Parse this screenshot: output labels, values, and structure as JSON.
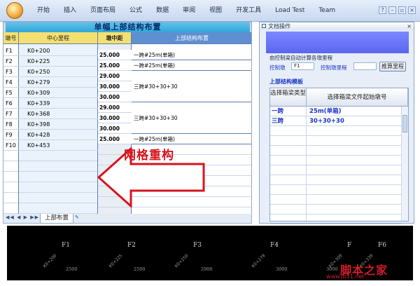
{
  "ribbon": {
    "tabs": [
      "开始",
      "插入",
      "页面布局",
      "公式",
      "数据",
      "审阅",
      "视图",
      "开发工具",
      "Load Test",
      "Team"
    ]
  },
  "sheet": {
    "title": "单幅上部结构布置",
    "headers": {
      "pier": "墩号",
      "station": "中心里程",
      "span": "墩中距",
      "layout": "上部结构布置"
    },
    "piers": [
      {
        "pier": "F1",
        "station": "K0+200"
      },
      {
        "pier": "F2",
        "station": "K0+225"
      },
      {
        "pier": "F3",
        "station": "K0+250"
      },
      {
        "pier": "F4",
        "station": "K0+279"
      },
      {
        "pier": "F5",
        "station": "K0+309"
      },
      {
        "pier": "F6",
        "station": "K0+339"
      },
      {
        "pier": "F7",
        "station": "K0+368"
      },
      {
        "pier": "F8",
        "station": "K0+398"
      },
      {
        "pier": "F9",
        "station": "K0+428"
      },
      {
        "pier": "F10",
        "station": "K0+453"
      }
    ],
    "spans": [
      "25.000",
      "25.000",
      "29.000",
      "30.000",
      "30.000",
      "29.000",
      "30.000",
      "30.000",
      "25.000"
    ],
    "layout_groups": [
      {
        "text": "一跨#25m(单箱)"
      },
      {
        "text": "一跨#25m(单箱)"
      },
      {
        "text": "三跨#30+30+30"
      },
      {
        "text": "三跨#30+30+30"
      },
      {
        "text": "一跨#25m(单箱)"
      }
    ],
    "arrow_label": "网格重构",
    "sheet_tab": "上部布置",
    "colors": {
      "title": "#3aaedc",
      "header": "#f4e070",
      "station_col": "#eaf3fb",
      "span_header": "#f4e070",
      "arrow": "#d6141e"
    }
  },
  "pane": {
    "title": "文档操作",
    "hint": "由控制梁自动计算各墩里程",
    "control_pier_label": "控制墩",
    "control_pier_value": "F1",
    "control_station_label": "控制墩里程",
    "control_station_value": "",
    "calc_button": "推算里程",
    "template_title": "上部结构模板",
    "grid_headers": {
      "col1": "选择箱梁类型",
      "col2": "选择箱梁文件起始墩号"
    },
    "grid_rows": [
      {
        "type": "一跨",
        "start": "25m(单箱)"
      },
      {
        "type": "三跨",
        "start": "30+30+30"
      }
    ]
  },
  "drawing": {
    "piers": [
      "F1",
      "F2",
      "F3",
      "F4",
      "F",
      "F6"
    ],
    "stations": [
      "K0+200",
      "K0+225",
      "K0+250",
      "K0+279",
      "K0+309",
      "K0+339"
    ],
    "dims": [
      "2500",
      "2500",
      "2900",
      "3000",
      "3000"
    ]
  },
  "watermark": {
    "cn": "脚本之家",
    "url": "www.jb51.net"
  }
}
